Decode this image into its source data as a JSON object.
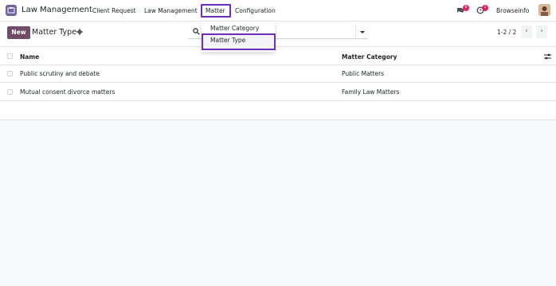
{
  "app": {
    "title": "Law Management",
    "icon": "law-app-icon"
  },
  "nav": {
    "items": [
      {
        "label": "Client Request"
      },
      {
        "label": "Law Management"
      },
      {
        "label": "Matter"
      },
      {
        "label": "Configuration"
      }
    ]
  },
  "systray": {
    "messages_count": "8",
    "activity_count": "1",
    "user_name": "Browseinfo"
  },
  "control": {
    "new_label": "New",
    "page_title": "Matter Type",
    "pager": "1-2 / 2"
  },
  "dropdown": {
    "items": [
      {
        "label": "Matter Category"
      },
      {
        "label": "Matter Type"
      }
    ]
  },
  "table": {
    "columns": [
      "Name",
      "Matter Category"
    ],
    "rows": [
      {
        "name": "Public scrutiny and debate",
        "category": "Public Matters"
      },
      {
        "name": "Mutual consent divorce matters",
        "category": "Family Law Matters"
      }
    ]
  },
  "colors": {
    "primary": "#714b67",
    "highlight_border": "#6f2dbd",
    "badge": "#e0245e"
  }
}
